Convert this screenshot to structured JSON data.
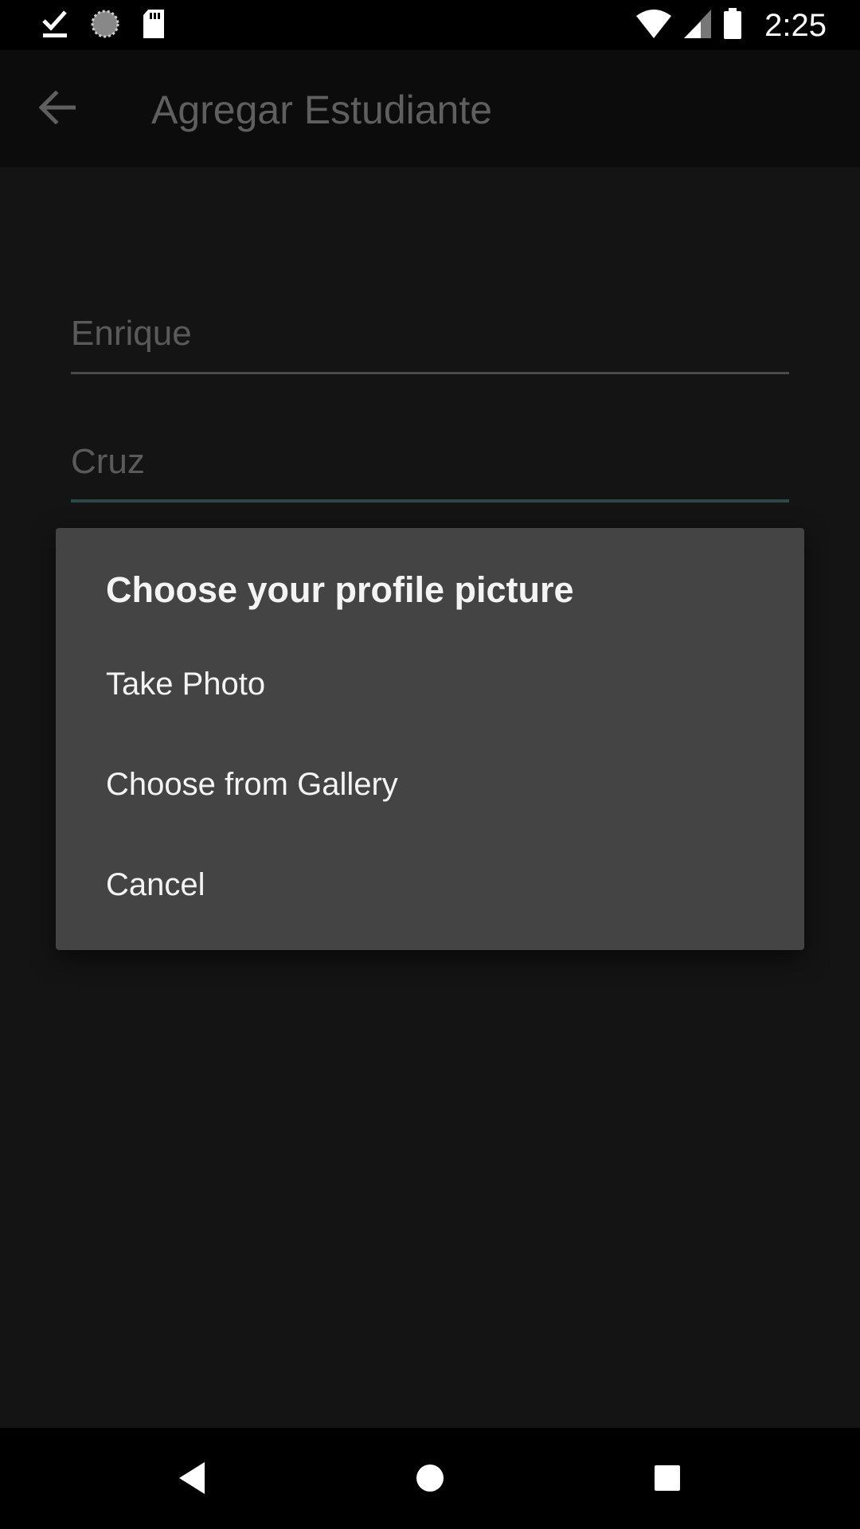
{
  "status_bar": {
    "time": "2:25",
    "icons": [
      "download-done-icon",
      "sync-icon",
      "sd-card-icon",
      "wifi-icon",
      "cell-signal-icon",
      "battery-icon"
    ]
  },
  "app_bar": {
    "title": "Agregar Estudiante",
    "back_icon": "arrow-back-icon"
  },
  "form": {
    "first_name": "Enrique",
    "last_name": "Cruz"
  },
  "dialog": {
    "title": "Choose your profile picture",
    "options": [
      "Take Photo",
      "Choose from Gallery",
      "Cancel"
    ]
  },
  "nav_bar": {
    "icons": [
      "nav-back-icon",
      "nav-home-icon",
      "nav-recents-icon"
    ]
  },
  "colors": {
    "background": "#141414",
    "dialog": "#444444",
    "focused_underline": "#2b4a47"
  }
}
